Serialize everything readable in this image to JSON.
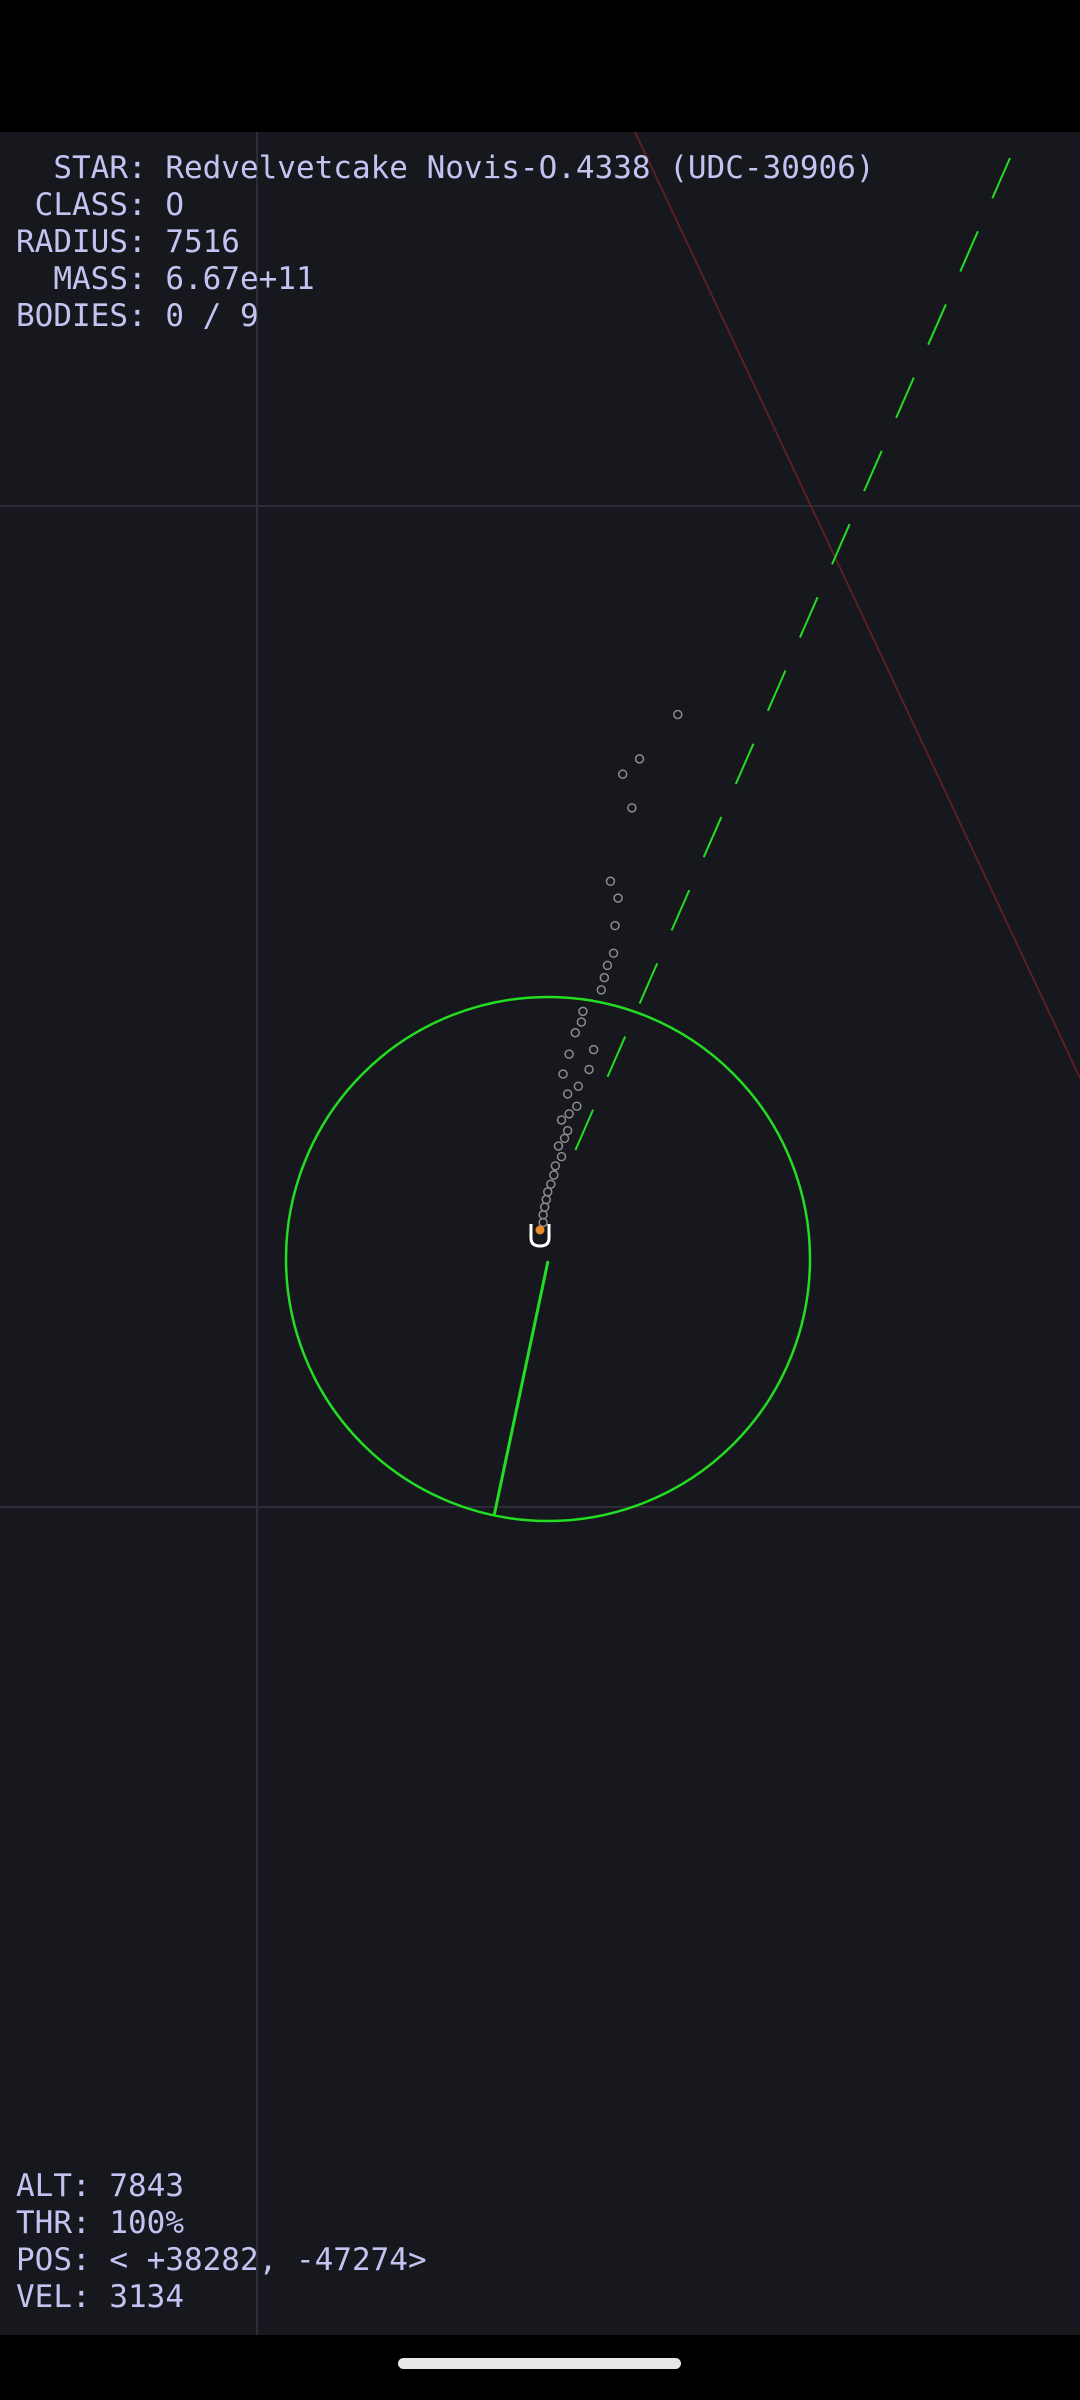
{
  "star_info": {
    "star_label": "  STAR: ",
    "star_value": "Redvelvetcake Novis-O.4338 (UDC-30906)",
    "class_label": " CLASS: ",
    "class_value": "O",
    "radius_label": "RADIUS: ",
    "radius_value": "7516",
    "mass_label": "  MASS: ",
    "mass_value": "6.67e+11",
    "bodies_label": "BODIES: ",
    "bodies_value": "0 / 9"
  },
  "ship_status": {
    "alt_label": "ALT: ",
    "alt_value": "7843",
    "thr_label": "THR: ",
    "thr_value": "100%",
    "pos_label": "POS: ",
    "pos_value": "< +38282, -47274>",
    "vel_label": "VEL: ",
    "vel_value": "3134",
    "throttle_fraction": 1.0
  },
  "colors": {
    "background": "#17181d",
    "hud_text": "#c3c3f2",
    "orbit": "#22dd22",
    "grid": "#2c2d38",
    "boundary": "#5a1f24",
    "trail": "#8a8a92",
    "ship_outline": "#ffffff",
    "ship_core": "#e8892a"
  }
}
